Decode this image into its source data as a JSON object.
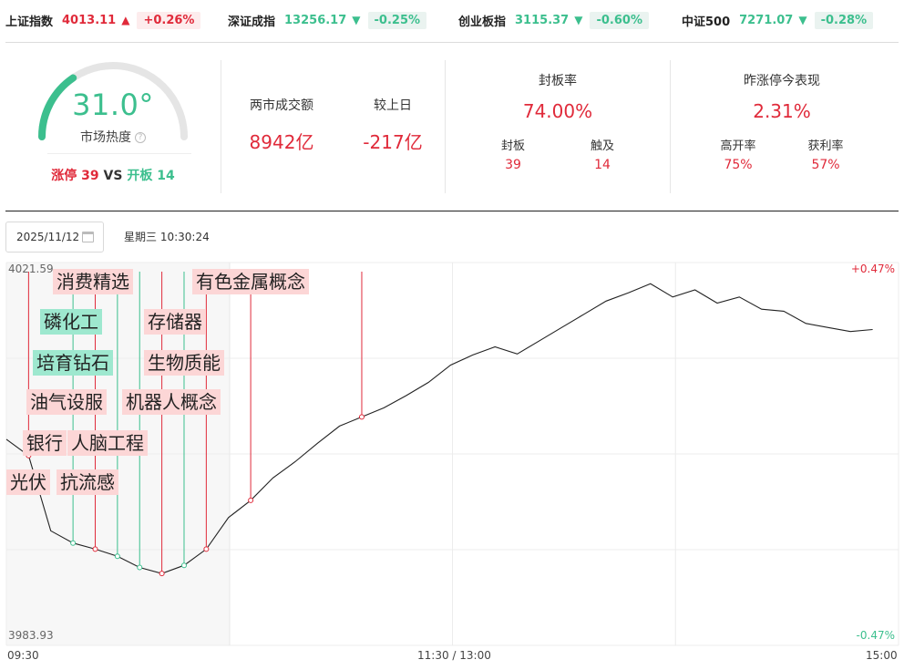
{
  "indices": [
    {
      "name": "上证指数",
      "value": "4013.11",
      "arrow": "▲",
      "change": "+0.26%",
      "dir": "up"
    },
    {
      "name": "深证成指",
      "value": "13256.17",
      "arrow": "▼",
      "change": "-0.25%",
      "dir": "down"
    },
    {
      "name": "创业板指",
      "value": "3115.37",
      "arrow": "▼",
      "change": "-0.60%",
      "dir": "down"
    },
    {
      "name": "中证500",
      "value": "7271.07",
      "arrow": "▼",
      "change": "-0.28%",
      "dir": "down"
    }
  ],
  "heat": {
    "value": "31.0°",
    "level": 0.31,
    "label": "市场热度",
    "help_icon": "?",
    "limit_up_label": "涨停",
    "limit_up_count": "39",
    "vs": "VS",
    "opened_label": "开板",
    "opened_count": "14"
  },
  "turnover": {
    "label": "两市成交额",
    "value": "8942亿",
    "compare_label": "较上日",
    "compare_value": "-217亿"
  },
  "seal": {
    "label": "封板率",
    "value": "74.00%",
    "sealed_label": "封板",
    "sealed_value": "39",
    "touched_label": "触及",
    "touched_value": "14"
  },
  "yesterday": {
    "label": "昨涨停今表现",
    "value": "2.31%",
    "high_open_label": "高开率",
    "high_open_value": "75%",
    "profit_label": "获利率",
    "profit_value": "57%"
  },
  "date": {
    "value": "2025/11/12",
    "icon": "calendar-icon",
    "weekday_time": "星期三 10:30:24"
  },
  "chart": {
    "y_max_label": "4021.59",
    "y_min_label": "3983.93",
    "pct_max_label": "+0.47%",
    "pct_min_label": "-0.47%",
    "x_start": "09:30",
    "x_mid": "11:30 / 13:00",
    "x_end": "15:00",
    "tags": [
      {
        "text": "消费精选",
        "color": "red"
      },
      {
        "text": "有色金属概念",
        "color": "red"
      },
      {
        "text": "磷化工",
        "color": "green"
      },
      {
        "text": "存储器",
        "color": "red"
      },
      {
        "text": "培育钻石",
        "color": "green"
      },
      {
        "text": "生物质能",
        "color": "red"
      },
      {
        "text": "油气设服",
        "color": "red"
      },
      {
        "text": "机器人概念",
        "color": "red"
      },
      {
        "text": "银行",
        "color": "red"
      },
      {
        "text": "人脑工程",
        "color": "red"
      },
      {
        "text": "光伏",
        "color": "red"
      },
      {
        "text": "抗流感",
        "color": "red"
      }
    ]
  },
  "colors": {
    "up": "#e02a3a",
    "down": "#3cbf8e",
    "gauge_track": "#e5e5e5",
    "line": "#222222"
  },
  "chart_data": {
    "type": "line",
    "ylim": [
      3983.93,
      4021.59
    ],
    "x_labels": [
      "09:30",
      "11:30 / 13:00",
      "15:00"
    ],
    "series": [
      {
        "values": [
          4004.2,
          4002.6,
          3995.2,
          3994.0,
          3993.4,
          3992.7,
          3991.6,
          3991.0,
          3991.8,
          3993.4,
          3996.5,
          3998.2,
          4000.4,
          4002.0,
          4003.8,
          4005.5,
          4006.4,
          4007.3,
          4008.5,
          4009.8,
          4011.5,
          4012.5,
          4013.3,
          4012.6,
          4013.9,
          4015.2,
          4016.5,
          4017.8,
          4018.6,
          4019.5,
          4018.2,
          4018.9,
          4017.6,
          4018.2,
          4017.0,
          4016.8,
          4015.6,
          4015.2,
          4014.8,
          4015.0
        ]
      }
    ]
  }
}
